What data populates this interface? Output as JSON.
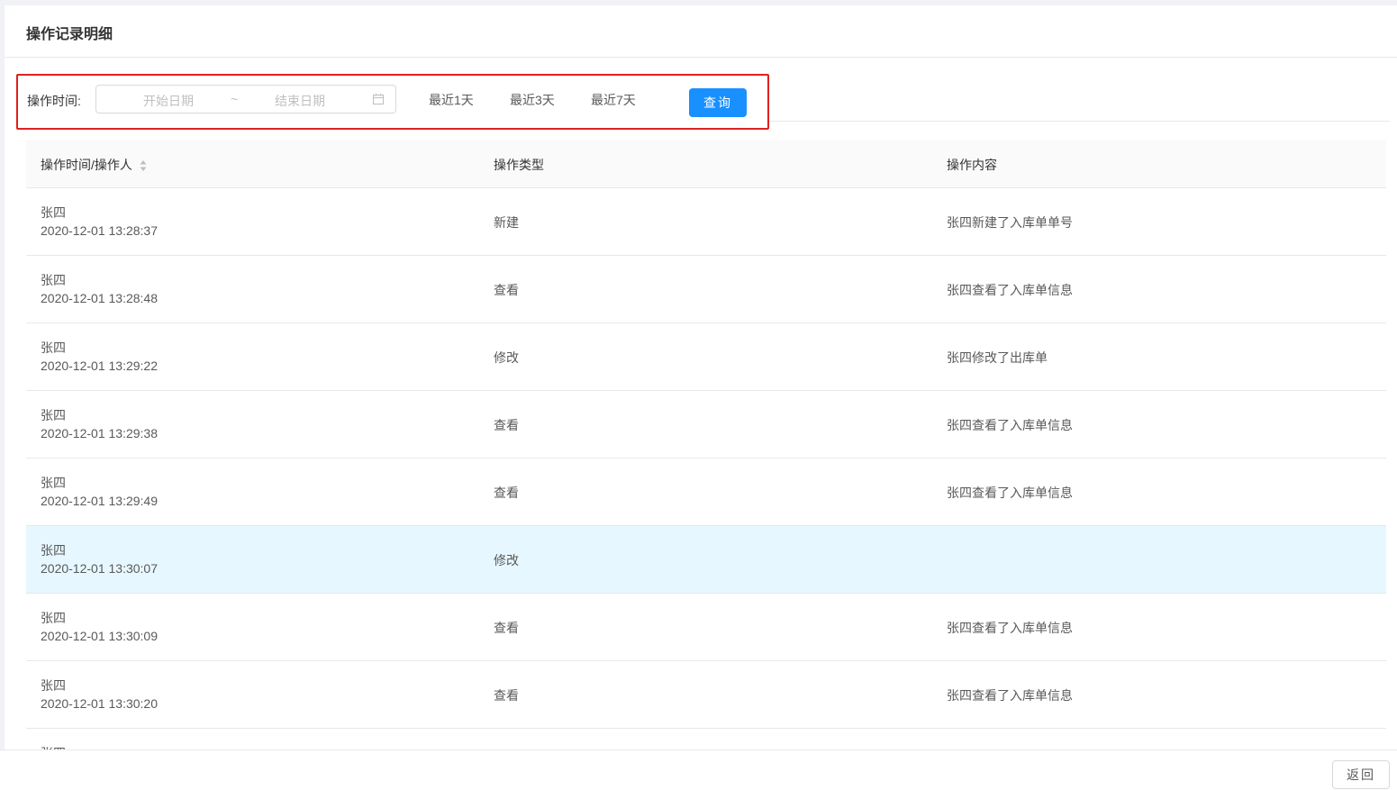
{
  "header": {
    "title": "操作记录明细"
  },
  "filter": {
    "label": "操作时间:",
    "start_placeholder": "开始日期",
    "separator": "~",
    "end_placeholder": "结束日期",
    "quick_options": [
      "最近1天",
      "最近3天",
      "最近7天"
    ],
    "query_label": "查询",
    "highlight_color": "#e02020"
  },
  "table": {
    "columns": [
      "操作时间/操作人",
      "操作类型",
      "操作内容"
    ],
    "rows": [
      {
        "name": "张四",
        "time": "2020-12-01 13:28:37",
        "type": "新建",
        "content": "张四新建了入库单单号"
      },
      {
        "name": "张四",
        "time": "2020-12-01 13:28:48",
        "type": "查看",
        "content": "张四查看了入库单信息"
      },
      {
        "name": "张四",
        "time": "2020-12-01 13:29:22",
        "type": "修改",
        "content": "张四修改了出库单"
      },
      {
        "name": "张四",
        "time": "2020-12-01 13:29:38",
        "type": "查看",
        "content": "张四查看了入库单信息"
      },
      {
        "name": "张四",
        "time": "2020-12-01 13:29:49",
        "type": "查看",
        "content": "张四查看了入库单信息"
      },
      {
        "name": "张四",
        "time": "2020-12-01 13:30:07",
        "type": "修改",
        "content": ""
      },
      {
        "name": "张四",
        "time": "2020-12-01 13:30:09",
        "type": "查看",
        "content": "张四查看了入库单信息"
      },
      {
        "name": "张四",
        "time": "2020-12-01 13:30:20",
        "type": "查看",
        "content": "张四查看了入库单信息"
      },
      {
        "name": "张四",
        "time": "",
        "type": "",
        "content": ""
      }
    ],
    "highlighted_row": 5,
    "highlight_color": "#e6f7ff"
  },
  "footer": {
    "back_label": "返回"
  },
  "colors": {
    "primary": "#1890ff",
    "border": "#e8e8e8"
  }
}
